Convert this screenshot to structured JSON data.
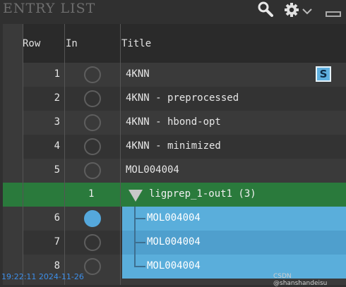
{
  "panel": {
    "title": "ENTRY LIST"
  },
  "toolbar": {
    "search_icon": "search-icon",
    "settings_icon": "gear-icon",
    "minimize_icon": "minimize-icon"
  },
  "columns": {
    "row": "Row",
    "in": "In",
    "title": "Title"
  },
  "entries": [
    {
      "row": "1",
      "included": false,
      "title": "4KNN",
      "badge": "S"
    },
    {
      "row": "2",
      "included": false,
      "title": "4KNN - preprocessed"
    },
    {
      "row": "3",
      "included": false,
      "title": "4KNN - hbond-opt"
    },
    {
      "row": "4",
      "included": false,
      "title": "4KNN - minimized"
    },
    {
      "row": "5",
      "included": false,
      "title": "MOL004004"
    }
  ],
  "group": {
    "count": "1",
    "title": "ligprep_1-out1 (3)",
    "expanded": true
  },
  "group_entries": [
    {
      "row": "6",
      "included": true,
      "title": "MOL004004"
    },
    {
      "row": "7",
      "included": false,
      "title": "MOL004004"
    },
    {
      "row": "8",
      "included": false,
      "title": "MOL004004"
    }
  ],
  "footer": {
    "timestamp": "19:22:11 2024-11-26",
    "watermark": "CSDN @shanshandeisu"
  },
  "colors": {
    "background": "#303030",
    "group_row": "#2a7a3c",
    "selected": "#5aaedb",
    "timestamp": "#3d8ee8"
  }
}
